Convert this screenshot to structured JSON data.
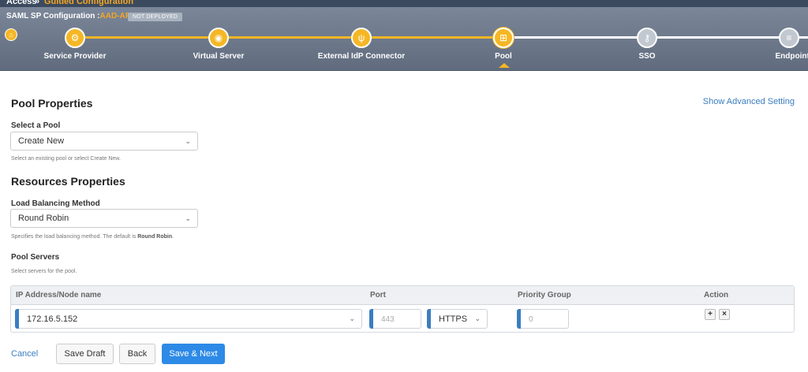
{
  "breadcrumb": {
    "root": "Access",
    "separator": "»",
    "current": "Guided Configuration"
  },
  "config": {
    "title_prefix": "SAML SP Configuration :",
    "name": "AAD-AP01",
    "status_badge": "NOT DEPLOYED"
  },
  "wizard": {
    "home_icon": "home-icon",
    "steps": [
      {
        "label": "Service Provider",
        "icon": "cogs-icon",
        "state": "done"
      },
      {
        "label": "Virtual Server",
        "icon": "globe-icon",
        "state": "done"
      },
      {
        "label": "External IdP Connector",
        "icon": "fork-icon",
        "state": "done"
      },
      {
        "label": "Pool",
        "icon": "sitemap-icon",
        "state": "current"
      },
      {
        "label": "SSO",
        "icon": "key-icon",
        "state": "todo"
      },
      {
        "label": "Endpoint Che",
        "icon": "list-icon",
        "state": "todo"
      }
    ]
  },
  "pool_properties": {
    "title": "Pool Properties",
    "advanced_link": "Show Advanced Setting",
    "select_pool_label": "Select a Pool",
    "select_pool_value": "Create New",
    "select_pool_hint": "Select an existing pool or select Create New."
  },
  "resources": {
    "title": "Resources Properties",
    "lb_label": "Load Balancing Method",
    "lb_value": "Round Robin",
    "lb_hint_prefix": "Specifies the load balancing method. The default is ",
    "lb_hint_bold": "Round Robin",
    "lb_hint_suffix": ".",
    "pool_servers_label": "Pool Servers",
    "pool_servers_hint": "Select servers for the pool."
  },
  "servers_table": {
    "headers": {
      "ip": "IP Address/Node name",
      "port": "Port",
      "priority": "Priority Group",
      "action": "Action"
    },
    "row": {
      "ip": "172.16.5.152",
      "port_placeholder": "443",
      "protocol": "HTTPS",
      "priority_placeholder": "0",
      "add": "+",
      "remove": "×"
    }
  },
  "footer": {
    "cancel": "Cancel",
    "save_draft": "Save Draft",
    "back": "Back",
    "save_next": "Save & Next"
  },
  "colors": {
    "accent": "#f5b724",
    "link": "#3a7ec1",
    "primary": "#2d8ae6",
    "header_bg": "#6b778a"
  }
}
